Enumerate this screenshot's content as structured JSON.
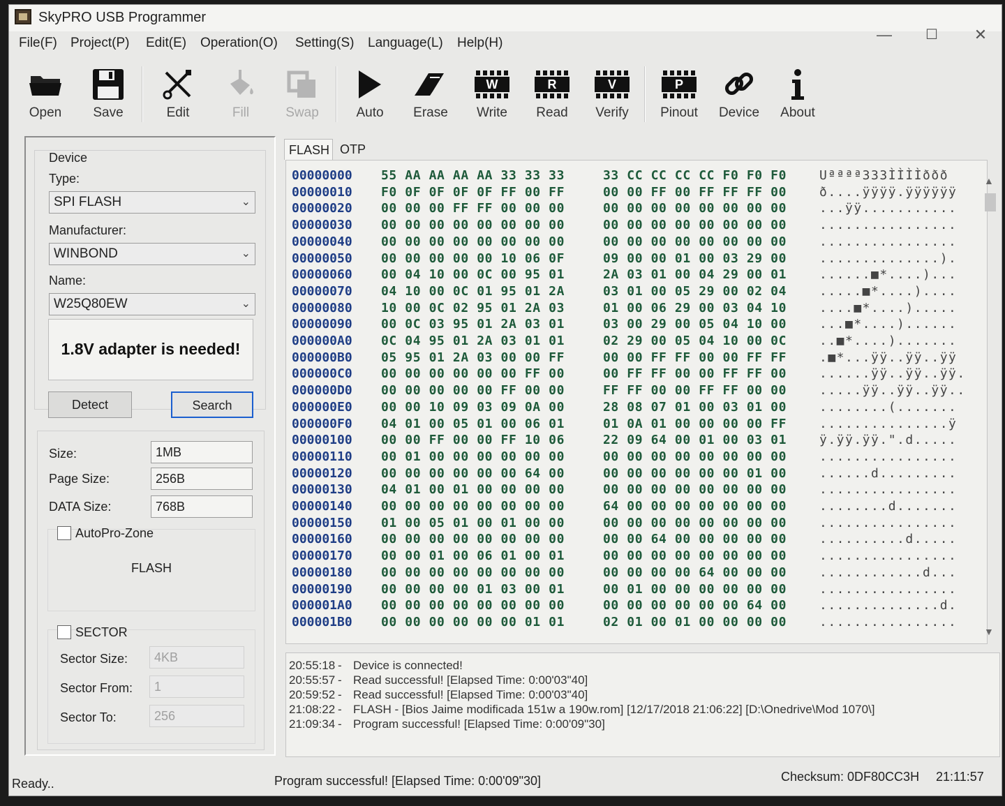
{
  "window": {
    "title": "SkyPRO USB Programmer",
    "min": "—",
    "max": "☐",
    "close": "✕"
  },
  "menu": [
    "File(F)",
    "Project(P)",
    "Edit(E)",
    "Operation(O)",
    "Setting(S)",
    "Language(L)",
    "Help(H)"
  ],
  "toolbar": {
    "open": "Open",
    "save": "Save",
    "edit": "Edit",
    "fill": "Fill",
    "swap": "Swap",
    "auto": "Auto",
    "erase": "Erase",
    "write": "Write",
    "read": "Read",
    "verify": "Verify",
    "pinout": "Pinout",
    "device": "Device",
    "about": "About",
    "write_letter": "W",
    "read_letter": "R",
    "verify_letter": "V",
    "pinout_letter": "P"
  },
  "device": {
    "group_label": "Device",
    "type_label": "Type:",
    "type_value": "SPI FLASH",
    "manufacturer_label": "Manufacturer:",
    "manufacturer_value": "WINBOND",
    "name_label": "Name:",
    "name_value": "W25Q80EW",
    "notice": "1.8V adapter is needed!",
    "detect": "Detect",
    "search": "Search"
  },
  "info": {
    "size_label": "Size:",
    "size_value": "1MB",
    "page_label": "Page Size:",
    "page_value": "256B",
    "data_label": "DATA Size:",
    "data_value": "768B",
    "autopro_label": "AutoPro-Zone",
    "zone_value": "FLASH",
    "sector_label": "SECTOR",
    "sector_size_label": "Sector Size:",
    "sector_size_value": "4KB",
    "sector_from_label": "Sector From:",
    "sector_from_value": "1",
    "sector_to_label": "Sector To:",
    "sector_to_value": "256"
  },
  "tabs": [
    "FLASH",
    "OTP"
  ],
  "hex_rows": [
    {
      "addr": "00000000",
      "b1": "55 AA AA AA AA 33 33 33",
      "b2": "33 CC CC CC CC F0 F0 F0",
      "asc": "Uªªªª333ÌÌÌÌððð"
    },
    {
      "addr": "00000010",
      "b1": "F0 0F 0F 0F 0F FF 00 FF",
      "b2": "00 00 FF 00 FF FF FF 00",
      "asc": "ð....ÿÿÿÿ.ÿÿÿÿÿÿ"
    },
    {
      "addr": "00000020",
      "b1": "00 00 00 FF FF 00 00 00",
      "b2": "00 00 00 00 00 00 00 00",
      "asc": "...ÿÿ..........."
    },
    {
      "addr": "00000030",
      "b1": "00 00 00 00 00 00 00 00",
      "b2": "00 00 00 00 00 00 00 00",
      "asc": "................"
    },
    {
      "addr": "00000040",
      "b1": "00 00 00 00 00 00 00 00",
      "b2": "00 00 00 00 00 00 00 00",
      "asc": "................"
    },
    {
      "addr": "00000050",
      "b1": "00 00 00 00 00 10 06 0F",
      "b2": "09 00 00 01 00 03 29 00",
      "asc": "..............)."
    },
    {
      "addr": "00000060",
      "b1": "00 04 10 00 0C 00 95 01",
      "b2": "2A 03 01 00 04 29 00 01",
      "asc": "......■*....)..."
    },
    {
      "addr": "00000070",
      "b1": "04 10 00 0C 01 95 01 2A",
      "b2": "03 01 00 05 29 00 02 04",
      "asc": ".....■*....)...."
    },
    {
      "addr": "00000080",
      "b1": "10 00 0C 02 95 01 2A 03",
      "b2": "01 00 06 29 00 03 04 10",
      "asc": "....■*....)....."
    },
    {
      "addr": "00000090",
      "b1": "00 0C 03 95 01 2A 03 01",
      "b2": "03 00 29 00 05 04 10 00",
      "asc": "...■*....)......"
    },
    {
      "addr": "000000A0",
      "b1": "0C 04 95 01 2A 03 01 01",
      "b2": "02 29 00 05 04 10 00 0C",
      "asc": "..■*....)......."
    },
    {
      "addr": "000000B0",
      "b1": "05 95 01 2A 03 00 00 FF",
      "b2": "00 00 FF FF 00 00 FF FF",
      "asc": ".■*...ÿÿ..ÿÿ..ÿÿ"
    },
    {
      "addr": "000000C0",
      "b1": "00 00 00 00 00 00 FF 00",
      "b2": "00 FF FF 00 00 FF FF 00",
      "asc": "......ÿÿ..ÿÿ..ÿÿ."
    },
    {
      "addr": "000000D0",
      "b1": "00 00 00 00 00 FF 00 00",
      "b2": "FF FF 00 00 FF FF 00 00",
      "asc": ".....ÿÿ..ÿÿ..ÿÿ.."
    },
    {
      "addr": "000000E0",
      "b1": "00 00 10 09 03 09 0A 00",
      "b2": "28 08 07 01 00 03 01 00",
      "asc": "........(......."
    },
    {
      "addr": "000000F0",
      "b1": "04 01 00 05 01 00 06 01",
      "b2": "01 0A 01 00 00 00 00 FF",
      "asc": "...............ÿ"
    },
    {
      "addr": "00000100",
      "b1": "00 00 FF 00 00 FF 10 06",
      "b2": "22 09 64 00 01 00 03 01",
      "asc": "ÿ.ÿÿ.ÿÿ.\".d....."
    },
    {
      "addr": "00000110",
      "b1": "00 01 00 00 00 00 00 00",
      "b2": "00 00 00 00 00 00 00 00",
      "asc": "................"
    },
    {
      "addr": "00000120",
      "b1": "00 00 00 00 00 00 64 00",
      "b2": "00 00 00 00 00 00 01 00",
      "asc": "......d........."
    },
    {
      "addr": "00000130",
      "b1": "04 01 00 01 00 00 00 00",
      "b2": "00 00 00 00 00 00 00 00",
      "asc": "................"
    },
    {
      "addr": "00000140",
      "b1": "00 00 00 00 00 00 00 00",
      "b2": "64 00 00 00 00 00 00 00",
      "asc": "........d......."
    },
    {
      "addr": "00000150",
      "b1": "01 00 05 01 00 01 00 00",
      "b2": "00 00 00 00 00 00 00 00",
      "asc": "................"
    },
    {
      "addr": "00000160",
      "b1": "00 00 00 00 00 00 00 00",
      "b2": "00 00 64 00 00 00 00 00",
      "asc": "..........d....."
    },
    {
      "addr": "00000170",
      "b1": "00 00 01 00 06 01 00 01",
      "b2": "00 00 00 00 00 00 00 00",
      "asc": "................"
    },
    {
      "addr": "00000180",
      "b1": "00 00 00 00 00 00 00 00",
      "b2": "00 00 00 00 64 00 00 00",
      "asc": "............d..."
    },
    {
      "addr": "00000190",
      "b1": "00 00 00 00 01 03 00 01",
      "b2": "00 01 00 00 00 00 00 00",
      "asc": "................"
    },
    {
      "addr": "000001A0",
      "b1": "00 00 00 00 00 00 00 00",
      "b2": "00 00 00 00 00 00 64 00",
      "asc": "..............d."
    },
    {
      "addr": "000001B0",
      "b1": "00 00 00 00 00 00 01 01",
      "b2": "02 01 00 01 00 00 00 00",
      "asc": "................"
    }
  ],
  "log": [
    {
      "time": "20:55:18",
      "dash": "-",
      "msg": "Device is connected!"
    },
    {
      "time": "20:55:57",
      "dash": "-",
      "msg": "Read successful! [Elapsed Time: 0:00'03\"40]"
    },
    {
      "time": "20:59:52",
      "dash": "-",
      "msg": "Read successful! [Elapsed Time: 0:00'03\"40]"
    },
    {
      "time": "21:08:22",
      "dash": "-",
      "msg": "FLASH - [Bios Jaime modificada 151w a 190w.rom] [12/17/2018 21:06:22] [D:\\Onedrive\\Mod 1070\\]"
    },
    {
      "time": "21:09:34",
      "dash": "-",
      "msg": "Program successful! [Elapsed Time: 0:00'09\"30]"
    }
  ],
  "status": {
    "ready": "Ready..",
    "message": "Program successful! [Elapsed Time: 0:00'09\"30]",
    "checksum": "Checksum: 0DF80CC3H",
    "clock": "21:11:57"
  }
}
